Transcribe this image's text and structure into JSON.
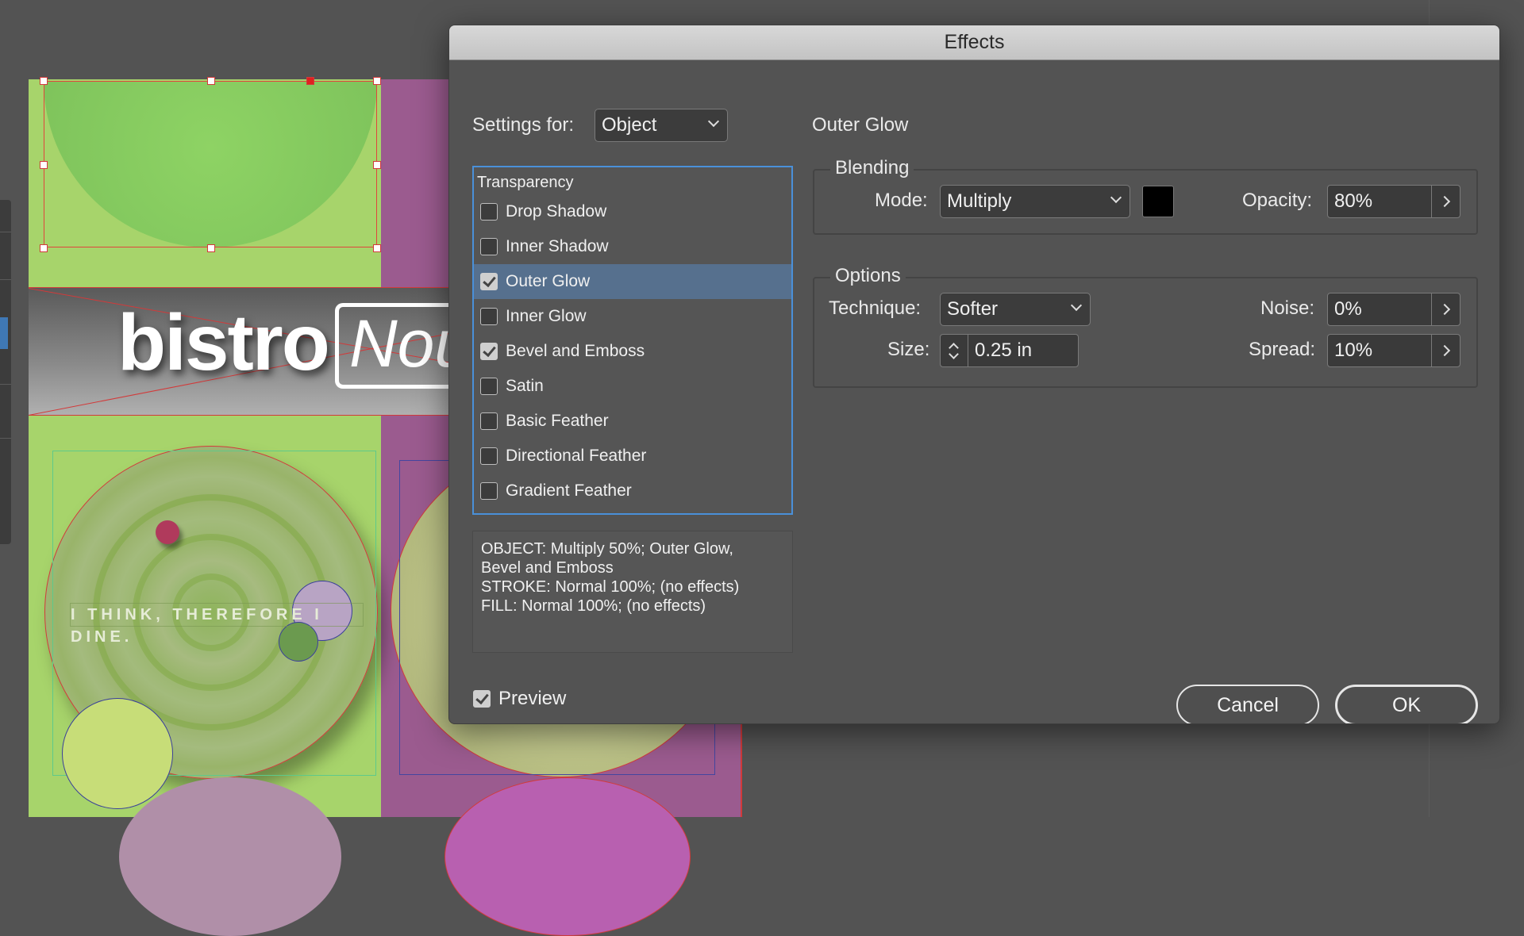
{
  "artwork": {
    "brand_word": "bistro",
    "brand_word_2": "Nou",
    "tagline": "I THINK, THEREFORE I DINE."
  },
  "dialog": {
    "title": "Effects",
    "settings_for_label": "Settings for:",
    "settings_for_value": "Object",
    "section_title": "Outer Glow",
    "effects_header": "Transparency",
    "effects": [
      {
        "label": "Drop Shadow",
        "checked": false,
        "selected": false
      },
      {
        "label": "Inner Shadow",
        "checked": false,
        "selected": false
      },
      {
        "label": "Outer Glow",
        "checked": true,
        "selected": true
      },
      {
        "label": "Inner Glow",
        "checked": false,
        "selected": false
      },
      {
        "label": "Bevel and Emboss",
        "checked": true,
        "selected": false
      },
      {
        "label": "Satin",
        "checked": false,
        "selected": false
      },
      {
        "label": "Basic Feather",
        "checked": false,
        "selected": false
      },
      {
        "label": "Directional Feather",
        "checked": false,
        "selected": false
      },
      {
        "label": "Gradient Feather",
        "checked": false,
        "selected": false
      }
    ],
    "summary": [
      "OBJECT: Multiply 50%; Outer Glow,",
      "Bevel and Emboss",
      "STROKE: Normal 100%; (no effects)",
      "FILL: Normal 100%; (no effects)"
    ],
    "blending": {
      "legend": "Blending",
      "mode_label": "Mode:",
      "mode_value": "Multiply",
      "color": "#000000",
      "opacity_label": "Opacity:",
      "opacity_value": "80%"
    },
    "options": {
      "legend": "Options",
      "technique_label": "Technique:",
      "technique_value": "Softer",
      "noise_label": "Noise:",
      "noise_value": "0%",
      "size_label": "Size:",
      "size_value": "0.25 in",
      "spread_label": "Spread:",
      "spread_value": "10%"
    },
    "preview_label": "Preview",
    "preview_checked": true,
    "cancel_label": "Cancel",
    "ok_label": "OK"
  },
  "colors": {
    "accent": "#4a90d9",
    "selection": "#56708e",
    "canvas_green": "#a7d46b",
    "canvas_purple": "#9b5b8f"
  }
}
